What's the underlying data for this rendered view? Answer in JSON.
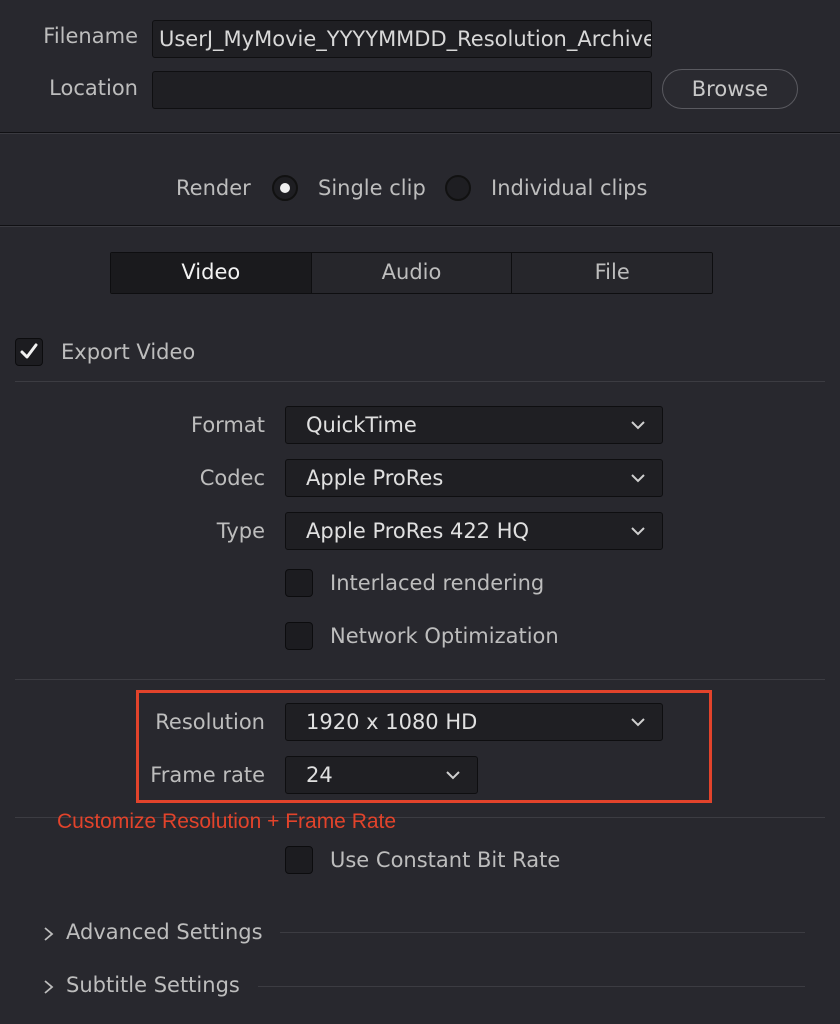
{
  "file": {
    "filename_label": "Filename",
    "filename_value": "UserJ_MyMovie_YYYYMMDD_Resolution_Archive",
    "location_label": "Location",
    "location_value": "",
    "browse_label": "Browse"
  },
  "render": {
    "label": "Render",
    "single_clip": "Single clip",
    "individual_clips": "Individual clips",
    "selected": "single_clip"
  },
  "tabs": [
    {
      "label": "Video",
      "active": true
    },
    {
      "label": "Audio",
      "active": false
    },
    {
      "label": "File",
      "active": false
    }
  ],
  "export_video": {
    "label": "Export Video",
    "checked": true
  },
  "video": {
    "format_label": "Format",
    "format_value": "QuickTime",
    "codec_label": "Codec",
    "codec_value": "Apple ProRes",
    "type_label": "Type",
    "type_value": "Apple ProRes 422 HQ",
    "interlaced_label": "Interlaced rendering",
    "network_label": "Network Optimization",
    "resolution_label": "Resolution",
    "resolution_value": "1920 x 1080 HD",
    "framerate_label": "Frame rate",
    "framerate_value": "24",
    "cbr_label": "Use Constant Bit Rate"
  },
  "annotation": {
    "text": "Customize Resolution + Frame Rate",
    "color": "#e2432b"
  },
  "sections": {
    "advanced": "Advanced Settings",
    "subtitle": "Subtitle Settings"
  },
  "icons": {
    "dropdown": "chevron-down-icon",
    "expander": "chevron-right-icon",
    "check": "checkmark-icon"
  }
}
